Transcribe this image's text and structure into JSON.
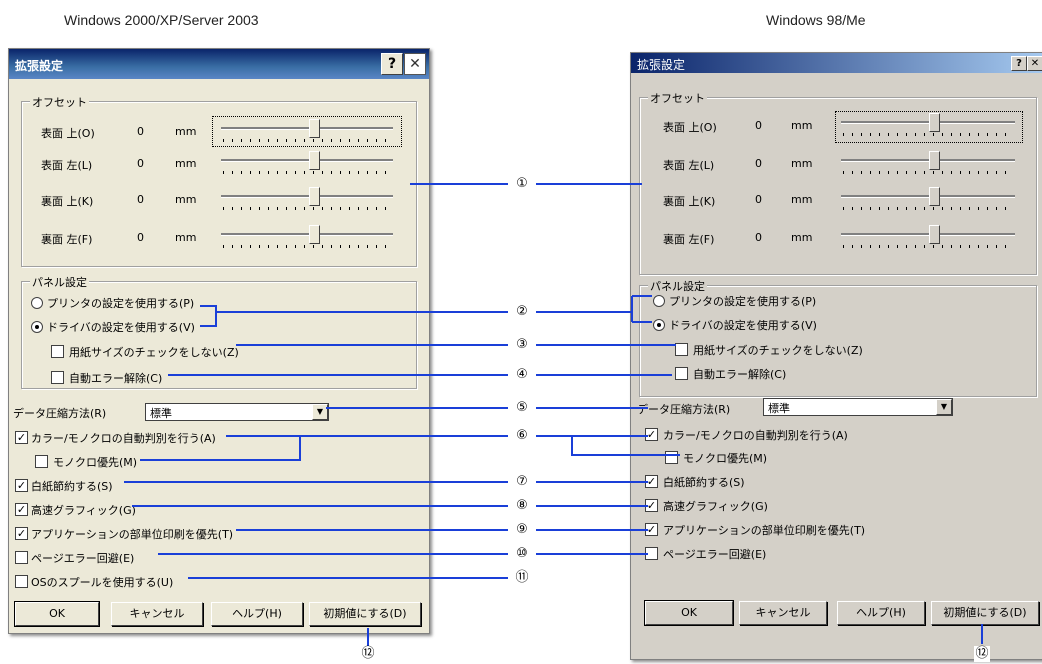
{
  "headings": {
    "left": "Windows 2000/XP/Server 2003",
    "right": "Windows 98/Me"
  },
  "dialog": {
    "title": "拡張設定",
    "title_98": "拡張設定",
    "help_glyph": "?",
    "close_glyph": "✕",
    "offset_group": "オフセット",
    "offsets": [
      {
        "label": "表面 上(O)",
        "value": "0",
        "unit": "mm",
        "position": 0.5
      },
      {
        "label": "表面 左(L)",
        "value": "0",
        "unit": "mm",
        "position": 0.5
      },
      {
        "label": "裏面 上(K)",
        "value": "0",
        "unit": "mm",
        "position": 0.5
      },
      {
        "label": "裏面 左(F)",
        "value": "0",
        "unit": "mm",
        "position": 0.5
      }
    ],
    "panel_group": "パネル設定",
    "radio_printer": "プリンタの設定を使用する(P)",
    "radio_driver": "ドライバの設定を使用する(V)",
    "selected_radio": "driver",
    "chk_paper": "用紙サイズのチェックをしない(Z)",
    "chk_autoerr": "自動エラー解除(C)",
    "compress_label": "データ圧縮方法(R)",
    "compress_value": "標準",
    "chk_color_auto": "カラー/モノクロの自動判別を行う(A)",
    "chk_mono_pri": "モノクロ優先(M)",
    "chk_blank": "白紙節約する(S)",
    "chk_fastgfx": "高速グラフィック(G)",
    "chk_app_unit": "アプリケーションの部単位印刷を優先(T)",
    "chk_page_err": "ページエラー回避(E)",
    "chk_os_spool": "OSのスプールを使用する(U)",
    "btn_ok": "OK",
    "btn_cancel": "キャンセル",
    "btn_help": "ヘルプ(H)",
    "btn_default": "初期値にする(D)",
    "checked": {
      "color_auto": true,
      "blank": true,
      "fastgfx": true,
      "app_unit": true,
      "paper": false,
      "autoerr": false,
      "mono_pri": false,
      "page_err": false,
      "os_spool": false
    },
    "check_glyph": "✓"
  },
  "callouts": [
    "①",
    "②",
    "③",
    "④",
    "⑤",
    "⑥",
    "⑦",
    "⑧",
    "⑨",
    "⑩",
    "⑪",
    "⑫"
  ],
  "colors": {
    "callout_line": "#1a3fd8",
    "xp_title": "#0a246a",
    "w98_title": "#0a246a"
  }
}
